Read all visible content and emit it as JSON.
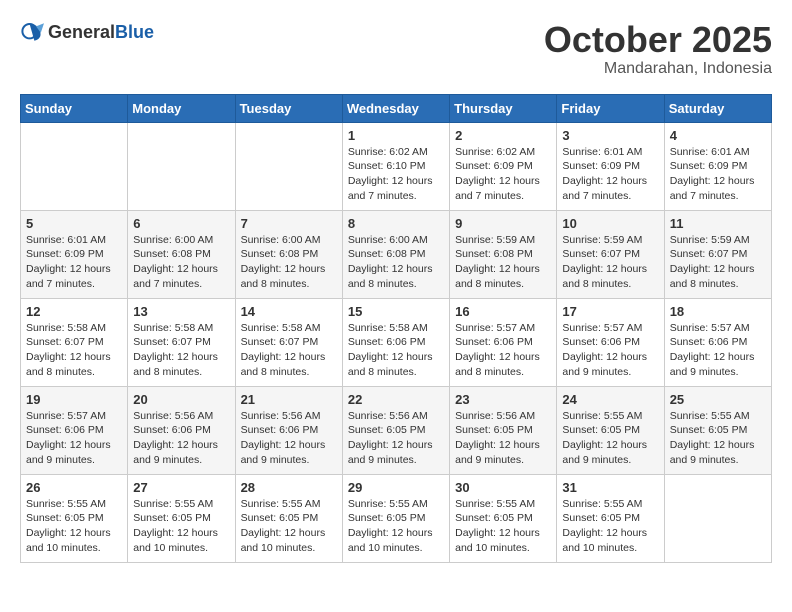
{
  "header": {
    "logo_general": "General",
    "logo_blue": "Blue",
    "month": "October 2025",
    "location": "Mandarahan, Indonesia"
  },
  "days_of_week": [
    "Sunday",
    "Monday",
    "Tuesday",
    "Wednesday",
    "Thursday",
    "Friday",
    "Saturday"
  ],
  "weeks": [
    [
      {
        "day": "",
        "info": ""
      },
      {
        "day": "",
        "info": ""
      },
      {
        "day": "",
        "info": ""
      },
      {
        "day": "1",
        "info": "Sunrise: 6:02 AM\nSunset: 6:10 PM\nDaylight: 12 hours and 7 minutes."
      },
      {
        "day": "2",
        "info": "Sunrise: 6:02 AM\nSunset: 6:09 PM\nDaylight: 12 hours and 7 minutes."
      },
      {
        "day": "3",
        "info": "Sunrise: 6:01 AM\nSunset: 6:09 PM\nDaylight: 12 hours and 7 minutes."
      },
      {
        "day": "4",
        "info": "Sunrise: 6:01 AM\nSunset: 6:09 PM\nDaylight: 12 hours and 7 minutes."
      }
    ],
    [
      {
        "day": "5",
        "info": "Sunrise: 6:01 AM\nSunset: 6:09 PM\nDaylight: 12 hours and 7 minutes."
      },
      {
        "day": "6",
        "info": "Sunrise: 6:00 AM\nSunset: 6:08 PM\nDaylight: 12 hours and 7 minutes."
      },
      {
        "day": "7",
        "info": "Sunrise: 6:00 AM\nSunset: 6:08 PM\nDaylight: 12 hours and 8 minutes."
      },
      {
        "day": "8",
        "info": "Sunrise: 6:00 AM\nSunset: 6:08 PM\nDaylight: 12 hours and 8 minutes."
      },
      {
        "day": "9",
        "info": "Sunrise: 5:59 AM\nSunset: 6:08 PM\nDaylight: 12 hours and 8 minutes."
      },
      {
        "day": "10",
        "info": "Sunrise: 5:59 AM\nSunset: 6:07 PM\nDaylight: 12 hours and 8 minutes."
      },
      {
        "day": "11",
        "info": "Sunrise: 5:59 AM\nSunset: 6:07 PM\nDaylight: 12 hours and 8 minutes."
      }
    ],
    [
      {
        "day": "12",
        "info": "Sunrise: 5:58 AM\nSunset: 6:07 PM\nDaylight: 12 hours and 8 minutes."
      },
      {
        "day": "13",
        "info": "Sunrise: 5:58 AM\nSunset: 6:07 PM\nDaylight: 12 hours and 8 minutes."
      },
      {
        "day": "14",
        "info": "Sunrise: 5:58 AM\nSunset: 6:07 PM\nDaylight: 12 hours and 8 minutes."
      },
      {
        "day": "15",
        "info": "Sunrise: 5:58 AM\nSunset: 6:06 PM\nDaylight: 12 hours and 8 minutes."
      },
      {
        "day": "16",
        "info": "Sunrise: 5:57 AM\nSunset: 6:06 PM\nDaylight: 12 hours and 8 minutes."
      },
      {
        "day": "17",
        "info": "Sunrise: 5:57 AM\nSunset: 6:06 PM\nDaylight: 12 hours and 9 minutes."
      },
      {
        "day": "18",
        "info": "Sunrise: 5:57 AM\nSunset: 6:06 PM\nDaylight: 12 hours and 9 minutes."
      }
    ],
    [
      {
        "day": "19",
        "info": "Sunrise: 5:57 AM\nSunset: 6:06 PM\nDaylight: 12 hours and 9 minutes."
      },
      {
        "day": "20",
        "info": "Sunrise: 5:56 AM\nSunset: 6:06 PM\nDaylight: 12 hours and 9 minutes."
      },
      {
        "day": "21",
        "info": "Sunrise: 5:56 AM\nSunset: 6:06 PM\nDaylight: 12 hours and 9 minutes."
      },
      {
        "day": "22",
        "info": "Sunrise: 5:56 AM\nSunset: 6:05 PM\nDaylight: 12 hours and 9 minutes."
      },
      {
        "day": "23",
        "info": "Sunrise: 5:56 AM\nSunset: 6:05 PM\nDaylight: 12 hours and 9 minutes."
      },
      {
        "day": "24",
        "info": "Sunrise: 5:55 AM\nSunset: 6:05 PM\nDaylight: 12 hours and 9 minutes."
      },
      {
        "day": "25",
        "info": "Sunrise: 5:55 AM\nSunset: 6:05 PM\nDaylight: 12 hours and 9 minutes."
      }
    ],
    [
      {
        "day": "26",
        "info": "Sunrise: 5:55 AM\nSunset: 6:05 PM\nDaylight: 12 hours and 10 minutes."
      },
      {
        "day": "27",
        "info": "Sunrise: 5:55 AM\nSunset: 6:05 PM\nDaylight: 12 hours and 10 minutes."
      },
      {
        "day": "28",
        "info": "Sunrise: 5:55 AM\nSunset: 6:05 PM\nDaylight: 12 hours and 10 minutes."
      },
      {
        "day": "29",
        "info": "Sunrise: 5:55 AM\nSunset: 6:05 PM\nDaylight: 12 hours and 10 minutes."
      },
      {
        "day": "30",
        "info": "Sunrise: 5:55 AM\nSunset: 6:05 PM\nDaylight: 12 hours and 10 minutes."
      },
      {
        "day": "31",
        "info": "Sunrise: 5:55 AM\nSunset: 6:05 PM\nDaylight: 12 hours and 10 minutes."
      },
      {
        "day": "",
        "info": ""
      }
    ]
  ]
}
